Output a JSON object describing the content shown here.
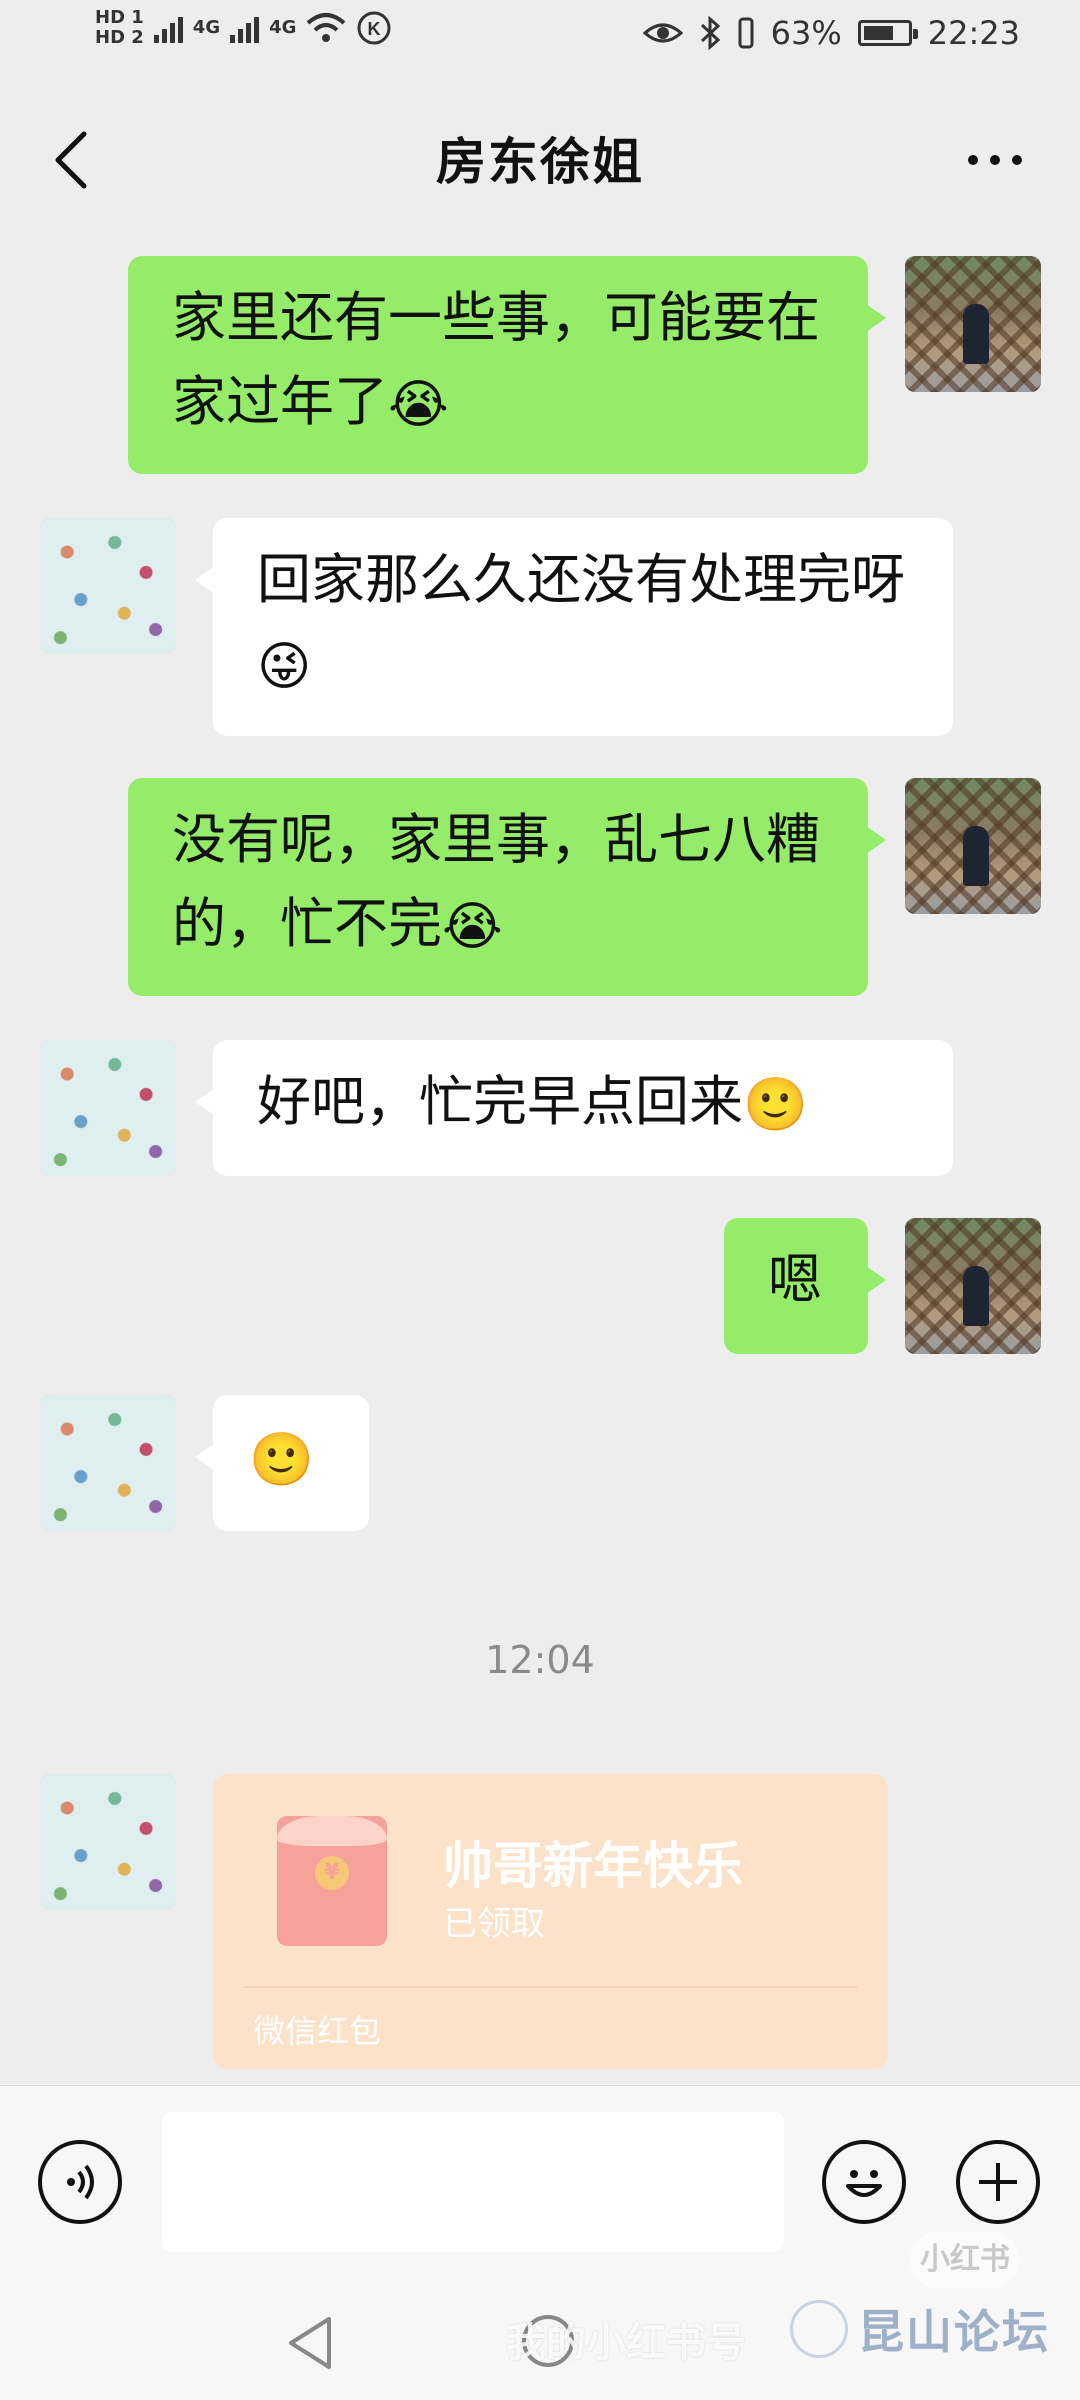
{
  "status_bar": {
    "hd1": "HD 1",
    "hd2": "HD 2",
    "net1": "4G",
    "net2": "4G",
    "battery": "63%",
    "time": "22:23"
  },
  "header": {
    "title": "房东徐姐"
  },
  "messages": [
    {
      "side": "me",
      "text": "家里还有一些事，可能要在家过年了",
      "emoji": "😭"
    },
    {
      "side": "other",
      "text": "回家那么久还没有处理完呀",
      "emoji": "😜"
    },
    {
      "side": "me",
      "text": "没有呢，家里事，乱七八糟的，忙不完",
      "emoji": "😭"
    },
    {
      "side": "other",
      "text": "好吧，忙完早点回来",
      "emoji": "🙂"
    },
    {
      "side": "me",
      "text": "嗯"
    },
    {
      "side": "other",
      "text": "",
      "emoji": "🙂"
    }
  ],
  "timestamp": "12:04",
  "red_packet": {
    "title": "帅哥新年快乐",
    "status": "已领取",
    "footer": "微信红包",
    "coin": "¥"
  },
  "input_bar": {
    "placeholder": ""
  },
  "watermark": {
    "text": "我的小红书号",
    "badge": "小红书",
    "brand": "昆山论坛"
  }
}
